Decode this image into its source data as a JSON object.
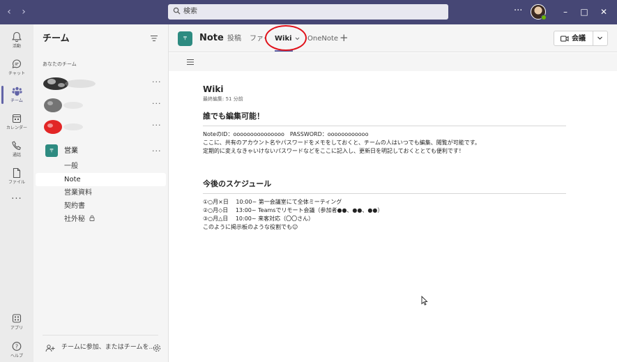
{
  "titlebar": {
    "search_placeholder": "検索",
    "more": "···"
  },
  "rail": {
    "items": [
      {
        "label": "活動",
        "icon": "bell-icon"
      },
      {
        "label": "チャット",
        "icon": "chat-icon"
      },
      {
        "label": "チーム",
        "icon": "teams-icon",
        "active": true
      },
      {
        "label": "カレンダー",
        "icon": "calendar-icon"
      },
      {
        "label": "通話",
        "icon": "phone-icon"
      },
      {
        "label": "ファイル",
        "icon": "file-icon"
      }
    ],
    "more": "···",
    "apps_label": "アプリ",
    "help_label": "ヘルプ"
  },
  "panel": {
    "title": "チーム",
    "section_label": "あなたのチーム",
    "more": "···",
    "team_name": "営業",
    "team_icon_text": "〒",
    "channels": [
      "一般",
      "Note",
      "営業資料",
      "契約書",
      "社外秘"
    ],
    "selected_channel": "Note",
    "join_text": "チームに参加、またはチームを..."
  },
  "header": {
    "channel_name": "Note",
    "channel_icon_text": "〒",
    "tabs": [
      "投稿",
      "ファイル",
      "Wiki",
      "OneNote"
    ],
    "active_tab": "Wiki",
    "add_tab": "+",
    "meet_label": "会議"
  },
  "wiki": {
    "title": "Wiki",
    "last_edited": "最終編集: 51 分前",
    "sections": [
      {
        "heading": "誰でも編集可能！",
        "lines": [
          "NoteのID：ooooooooooooooo　PASSWORD：oooooooooooo",
          "ここに、共有のアカウント名やパスワードをメモをしておくと、チームの人はいつでも編集、閲覧が可能です。",
          "定期的に変えなきゃいけないパスワードなどをここに記入し、更新日を明記しておくととても便利です！"
        ]
      },
      {
        "heading": "今後のスケジュール",
        "lines": [
          "①○月×日　 10:00~ 第一会議室にて全体ミーティング",
          "②○月◇日　 13:00~ Teamsでリモート会議（参加者●●、●●、●●）",
          "③○月△日　 10:00~  来客対応（〇〇さん）",
          "このように掲示板のような役割でも☺"
        ]
      }
    ]
  },
  "colors": {
    "titlebar": "#464775",
    "accent": "#6264a7",
    "team_icon": "#2e8b81",
    "highlight_circle": "#e0121b"
  }
}
